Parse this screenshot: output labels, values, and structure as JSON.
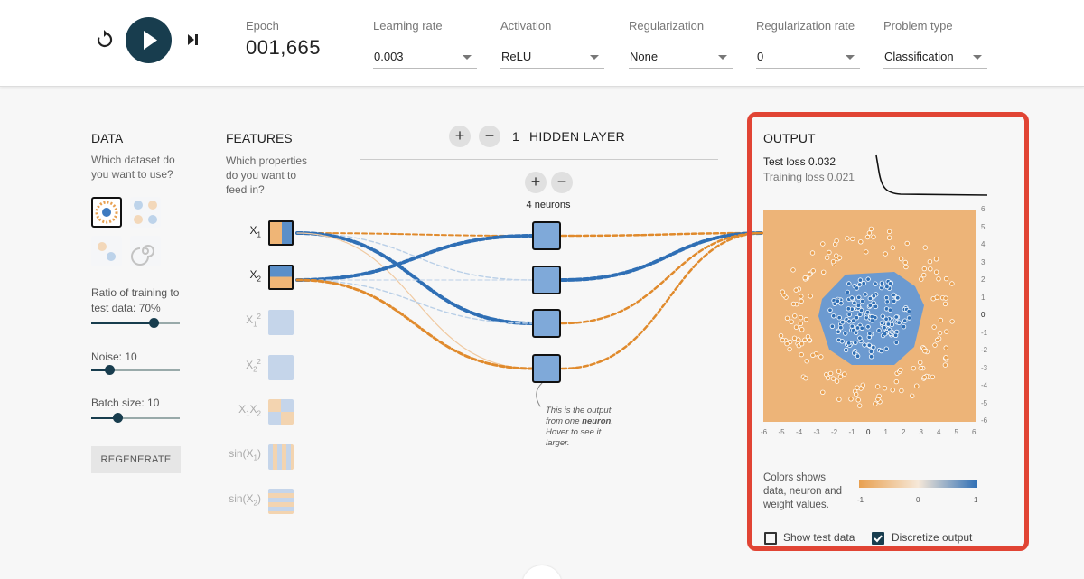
{
  "controls": {
    "epoch_label": "Epoch",
    "epoch_value": "001,665",
    "fields": [
      {
        "label": "Learning rate",
        "value": "0.003"
      },
      {
        "label": "Activation",
        "value": "ReLU"
      },
      {
        "label": "Regularization",
        "value": "None"
      },
      {
        "label": "Regularization rate",
        "value": "0"
      },
      {
        "label": "Problem type",
        "value": "Classification"
      }
    ]
  },
  "data_panel": {
    "title": "DATA",
    "subtitle_line1": "Which dataset do",
    "subtitle_line2": "you want to use?",
    "ratio_label_line1": "Ratio of training to",
    "ratio_label_line2": "test data:  70%",
    "ratio_value": 0.7,
    "noise_label": "Noise:  10",
    "noise_value": 0.2,
    "batch_label": "Batch size:  10",
    "batch_value": 0.3,
    "regenerate_label": "REGENERATE"
  },
  "features_panel": {
    "title": "FEATURES",
    "sub1": "Which properties",
    "sub2": "do you want to",
    "sub3": "feed in?",
    "features": [
      {
        "base": "X",
        "sub": "1",
        "sup": "",
        "active": true
      },
      {
        "base": "X",
        "sub": "2",
        "sup": "",
        "active": true
      },
      {
        "base": "X",
        "sub": "1",
        "sup": "2",
        "active": false
      },
      {
        "base": "X",
        "sub": "2",
        "sup": "2",
        "active": false
      },
      {
        "base": "X",
        "sub": "1",
        "base2": "X",
        "sub2": "2",
        "active": false
      },
      {
        "base": "sin(X",
        "sub": "1",
        "tail": ")",
        "active": false
      },
      {
        "base": "sin(X",
        "sub": "2",
        "tail": ")",
        "active": false
      }
    ]
  },
  "network": {
    "layer_count": "1",
    "layer_label": "HIDDEN LAYER",
    "neurons_label": "4 neurons",
    "tooltip_line1": "This is the output",
    "tooltip_line2a": "from one ",
    "tooltip_line2b": "neuron",
    "tooltip_line2c": ".",
    "tooltip_line3": "Hover to see it",
    "tooltip_line4": "larger."
  },
  "output_panel": {
    "title": "OUTPUT",
    "test_loss_label": "Test loss ",
    "test_loss_value": "0.032",
    "training_loss_label": "Training loss ",
    "training_loss_value": "0.021",
    "y_ticks": [
      "6",
      "5",
      "4",
      "3",
      "2",
      "1",
      "0",
      "-1",
      "-2",
      "-3",
      "-4",
      "-5",
      "-6"
    ],
    "x_ticks": [
      "-6",
      "-5",
      "-4",
      "-3",
      "-2",
      "-1",
      "0",
      "1",
      "2",
      "3",
      "4",
      "5",
      "6"
    ],
    "legend_line1": "Colors shows",
    "legend_line2": "data, neuron and",
    "legend_line3": "weight values.",
    "scale_min": "-1",
    "scale_mid": "0",
    "scale_max": "1",
    "show_test_label": "Show test data",
    "show_test_checked": false,
    "discretize_label": "Discretize output",
    "discretize_checked": true
  },
  "colors": {
    "positive": "#2f6fb5",
    "negative": "#e08a2c",
    "highlight": "#e14434",
    "dark": "#183d4e"
  }
}
